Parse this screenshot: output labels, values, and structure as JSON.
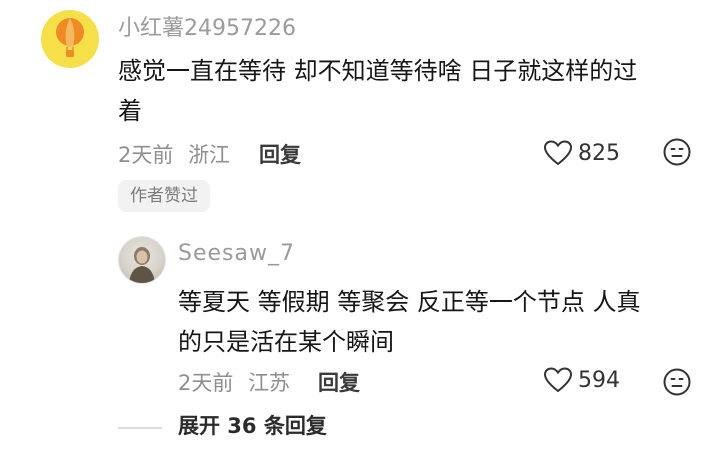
{
  "comment": {
    "username": "小红薯24957226",
    "text_line1": "感觉一直在等待 却不知道等待啥 日子就这样的过",
    "text_line2": "着",
    "date": "2天前",
    "location": "浙江",
    "reply_label": "回复",
    "likes": "825",
    "author_tag": "作者赞过"
  },
  "reply": {
    "username": "Seesaw_7",
    "text_line1": "等夏天 等假期 等聚会 反正等一个节点 人真",
    "text_line2": "的只是活在某个瞬间",
    "date": "2天前",
    "location": "江苏",
    "reply_label": "回复",
    "likes": "594"
  },
  "expand": {
    "label": "展开 36 条回复"
  },
  "colors": {
    "avatar_yellow": "#f6e04a",
    "balloon_orange": "#f08a24",
    "meta_gray": "#8f8f8f"
  }
}
